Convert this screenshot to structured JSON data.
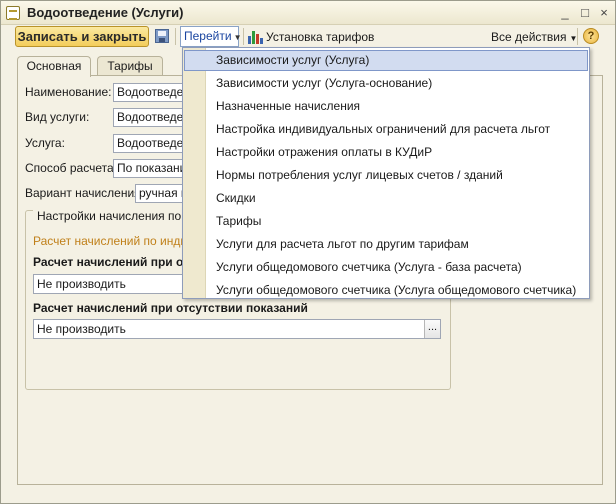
{
  "window": {
    "title": "Водоотведение (Услуги)"
  },
  "titlebar": {
    "minimize": "_",
    "maximize": "□",
    "close": "×"
  },
  "toolbar": {
    "save_close_label": "Записать и закрыть",
    "goto_label": "Перейти",
    "tariff_label": "Установка тарифов",
    "all_actions_label": "Все действия",
    "help_label": "?"
  },
  "tabs": [
    {
      "label": "Основная"
    },
    {
      "label": "Тарифы"
    }
  ],
  "form": {
    "name_label": "Наименование:",
    "name_value": "Водоотведение",
    "service_kind_label": "Вид услуги:",
    "service_kind_value": "Водоотведение",
    "service_label": "Услуга:",
    "service_value": "Водоотведение",
    "calc_method_label": "Способ расчета:",
    "calc_method_value": "По показаниям",
    "charge_variant_label": "Вариант начисления:",
    "charge_variant_value": "ручная на"
  },
  "group": {
    "title": "Настройки начисления по Инд",
    "orange_text": "Расчет начислений по индивид",
    "heading1": "Расчет начислений при о",
    "field1_value": "Не производить",
    "heading2": "Расчет начислений при отсутствии показаний",
    "field2_value": "Не производить",
    "dots": "..."
  },
  "dropdown": {
    "items": [
      "Зависимости услуг (Услуга)",
      "Зависимости услуг (Услуга-основание)",
      "Назначенные начисления",
      "Настройка индивидуальных ограничений для расчета льгот",
      "Настройки отражения оплаты в КУДиР",
      "Нормы потребления услуг лицевых счетов / зданий",
      "Скидки",
      "Тарифы",
      "Услуги для расчета льгот по другим тарифам",
      "Услуги общедомового счетчика (Услуга - база расчета)",
      "Услуги общедомового счетчика (Услуга общедомового счетчика)"
    ],
    "selected_index": 0
  },
  "colors": {
    "accent_button": "#f3cd5b",
    "link_blue": "#1a45a0",
    "orange_text": "#c0801a",
    "selection": "#d2dcf0"
  }
}
